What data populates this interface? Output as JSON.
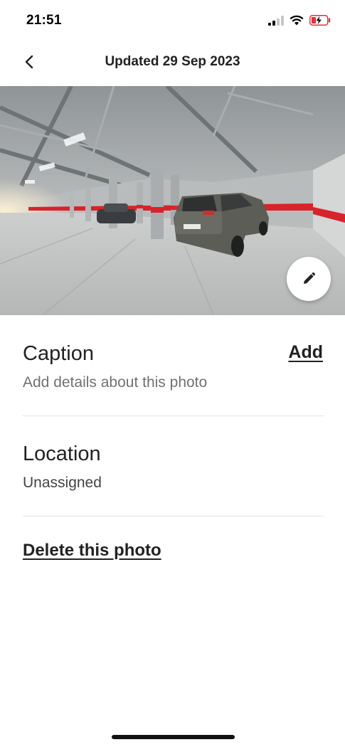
{
  "status_bar": {
    "time": "21:51",
    "icons": [
      "cellular-signal-icon",
      "wifi-icon",
      "battery-charging-icon"
    ]
  },
  "header": {
    "back_icon": "chevron-left-icon",
    "title": "Updated 29 Sep 2023"
  },
  "photo": {
    "description_icon": "pencil-icon"
  },
  "caption": {
    "title": "Caption",
    "action_label": "Add",
    "placeholder": "Add details about this photo"
  },
  "location": {
    "title": "Location",
    "value": "Unassigned"
  },
  "delete": {
    "label": "Delete this photo"
  },
  "colors": {
    "text_primary": "#222222",
    "text_secondary": "#717171",
    "divider": "#e3e3e3",
    "stripe_red": "#d8232a",
    "battery_red": "#e0303a"
  }
}
